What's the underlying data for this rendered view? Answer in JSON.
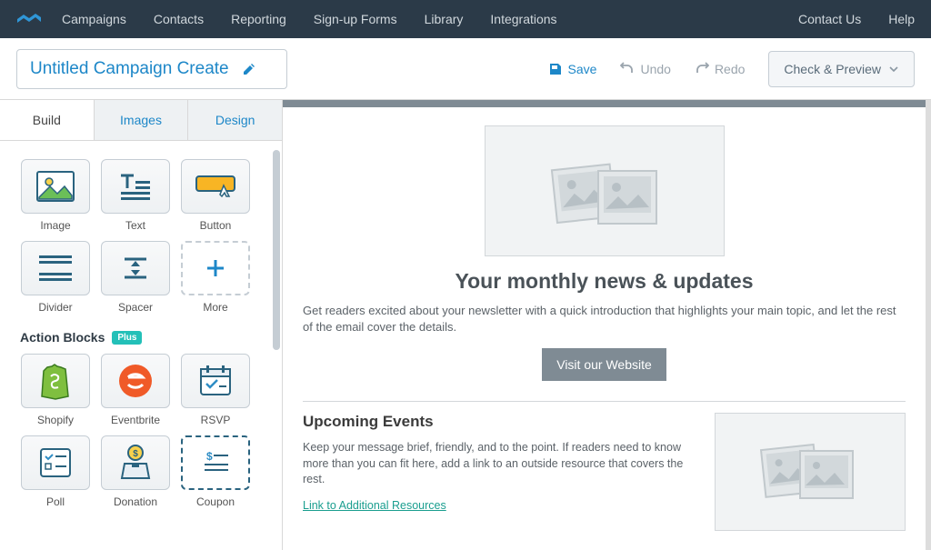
{
  "nav": {
    "items": [
      "Campaigns",
      "Contacts",
      "Reporting",
      "Sign-up Forms",
      "Library",
      "Integrations"
    ],
    "right": [
      "Contact Us",
      "Help"
    ]
  },
  "header": {
    "title": "Untitled Campaign Create",
    "save": "Save",
    "undo": "Undo",
    "redo": "Redo",
    "check_preview": "Check & Preview"
  },
  "sidebar": {
    "tabs": [
      {
        "label": "Build",
        "active": true
      },
      {
        "label": "Images",
        "active": false
      },
      {
        "label": "Design",
        "active": false
      }
    ],
    "blocks": [
      {
        "label": "Image"
      },
      {
        "label": "Text"
      },
      {
        "label": "Button"
      },
      {
        "label": "Divider"
      },
      {
        "label": "Spacer"
      },
      {
        "label": "More"
      }
    ],
    "action_section": {
      "title": "Action Blocks",
      "badge": "Plus",
      "blocks": [
        {
          "label": "Shopify"
        },
        {
          "label": "Eventbrite"
        },
        {
          "label": "RSVP"
        },
        {
          "label": "Poll"
        },
        {
          "label": "Donation"
        },
        {
          "label": "Coupon"
        }
      ]
    }
  },
  "preview": {
    "hero_title": "Your monthly news & updates",
    "hero_desc": "Get readers excited about your newsletter with a quick introduction that highlights your main topic, and let the rest of the email cover the details.",
    "cta": "Visit our Website",
    "events_title": "Upcoming Events",
    "events_desc": "Keep your message brief, friendly, and to the point. If readers need to know more than you can fit here, add a link to an outside resource that covers the rest.",
    "events_link": "Link to Additional Resources"
  },
  "colors": {
    "primary": "#1d87c8",
    "teal": "#23c0b8"
  }
}
